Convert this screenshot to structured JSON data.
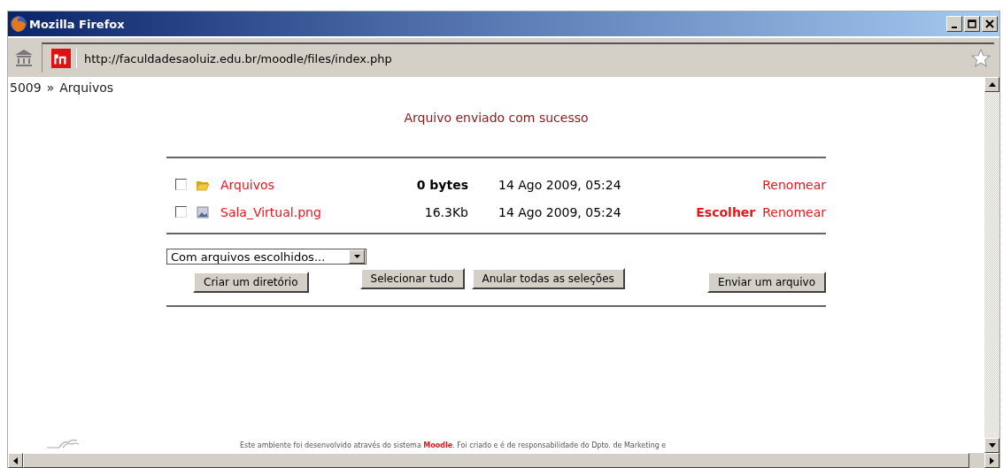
{
  "window": {
    "title": "Mozilla Firefox"
  },
  "address_bar": {
    "url": "http://faculdadesaoluiz.edu.br/moodle/files/index.php"
  },
  "breadcrumb": [
    "5009",
    "»",
    "Arquivos"
  ],
  "message": "Arquivo enviado com sucesso",
  "files": [
    {
      "kind": "folder",
      "name": "Arquivos",
      "size": "0 bytes",
      "modified": "14 Ago 2009, 05:24",
      "actions": [
        "Renomear"
      ],
      "checked": false
    },
    {
      "kind": "image",
      "name": "Sala_Virtual.png",
      "size": "16.3Kb",
      "modified": "14 Ago 2009, 05:24",
      "actions": [
        "Escolher",
        "Renomear"
      ],
      "checked": false
    }
  ],
  "bulk_select": {
    "value": "Com arquivos escolhidos..."
  },
  "buttons": [
    "Criar um diretório",
    "Selecionar tudo",
    "Anular todas as seleções",
    "Enviar um arquivo"
  ],
  "footer": "Este ambiente foi desenvolvido através do sistema **Moodle**. Foi criado e é de responsabilidade do Dpto. de Marketing e"
}
